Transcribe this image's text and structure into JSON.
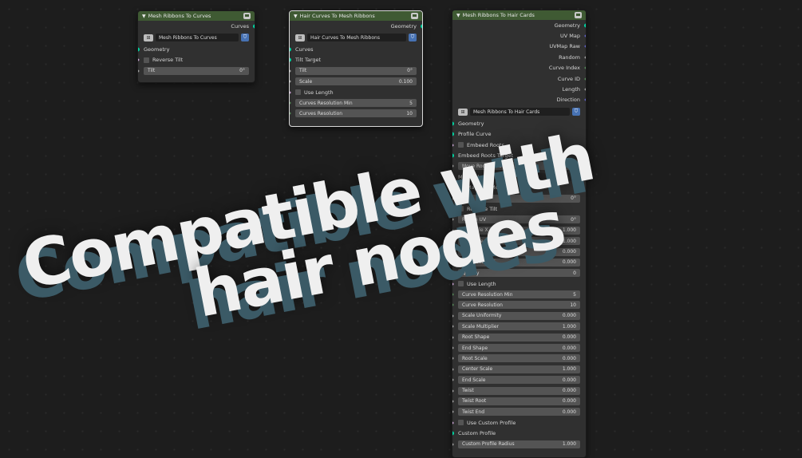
{
  "node1": {
    "title": "Mesh Ribbons To Curves",
    "output_label": "Curves",
    "group_name": "Mesh Ribbons To Curves",
    "inputs": {
      "geometry": "Geometry",
      "reverse_tilt": "Reverse Tilt",
      "tilt_label": "Tilt",
      "tilt_value": "0°"
    }
  },
  "node2": {
    "title": "Hair Curves To Mesh Ribbons",
    "output_label": "Geometry",
    "group_name": "Hair Curves To Mesh Ribbons",
    "inputs": {
      "curves": "Curves",
      "tilt_target": "Tilt Target",
      "tilt_label": "Tilt",
      "tilt_value": "0°",
      "scale_label": "Scale",
      "scale_value": "0.100",
      "use_length": "Use Length",
      "res_min_label": "Curves Resolution Min",
      "res_min_value": "5",
      "res_label": "Curves Resolution",
      "res_value": "10"
    }
  },
  "node3": {
    "title": "Mesh Ribbons To Hair Cards",
    "outputs": [
      "Geometry",
      "UV Map",
      "UVMap Raw",
      "Random",
      "Curve Index",
      "Curve ID",
      "Length",
      "Direction"
    ],
    "group_name": "Mesh Ribbons To Hair Cards",
    "inputs": {
      "geometry": "Geometry",
      "profile_curve": "Profile Curve",
      "embeed_roots": "Embeed Roots",
      "embeed_roots_target": "Embeed Roots Target",
      "move_roots_label": "Move Roots Below Mesh",
      "move_roots_value": "0.000",
      "material_label": "Material:",
      "mapping_mode": "Mapping Mode",
      "tilt_label": "Tilt",
      "tilt_value": "0°",
      "reverse_tilt": "Reverse Tilt",
      "rotate_uv_label": "Rotate UV",
      "rotate_uv_value": "0°",
      "uv_scale_x_label": "UV Scale X",
      "uv_scale_x_value": "1.000",
      "uv_scale_y_label": "UV Scale Y",
      "uv_scale_y_value": "1.000",
      "uv_loc_x_label": "UV Location X",
      "uv_loc_x_value": "0.000",
      "uv_loc_y_label": "UV Location Y",
      "uv_loc_y_value": "0.000",
      "quality_label": "Quality",
      "quality_value": "0",
      "use_length": "Use Length",
      "curve_res_min_label": "Curve Resolution Min",
      "curve_res_min_value": "5",
      "curve_res_label": "Curve Resolution",
      "curve_res_value": "10",
      "scale_uniformity_label": "Scale Uniformity",
      "scale_uniformity_value": "0.000",
      "scale_multiplier_label": "Scale Multiplier",
      "scale_multiplier_value": "1.000",
      "root_shape_label": "Root Shape",
      "root_shape_value": "0.000",
      "end_shape_label": "End Shape",
      "end_shape_value": "0.000",
      "root_scale_label": "Root Scale",
      "root_scale_value": "0.000",
      "center_scale_label": "Center Scale",
      "center_scale_value": "1.000",
      "end_scale_label": "End Scale",
      "end_scale_value": "0.000",
      "twist_label": "Twist",
      "twist_value": "0.000",
      "twist_root_label": "Twist Root",
      "twist_root_value": "0.000",
      "twist_end_label": "Twist End",
      "twist_end_value": "0.000",
      "use_custom_profile": "Use Custom Profile",
      "custom_profile": "Custom Profile",
      "custom_profile_radius_label": "Custom Profile Radius",
      "custom_profile_radius_value": "1.000"
    }
  },
  "overlay": {
    "line1": "Compatible with",
    "line2": "hair nodes"
  },
  "colors": {
    "header_green": "#3f5a33",
    "geometry_socket": "#00d6a3",
    "fake_user_blue": "#4772b3"
  }
}
